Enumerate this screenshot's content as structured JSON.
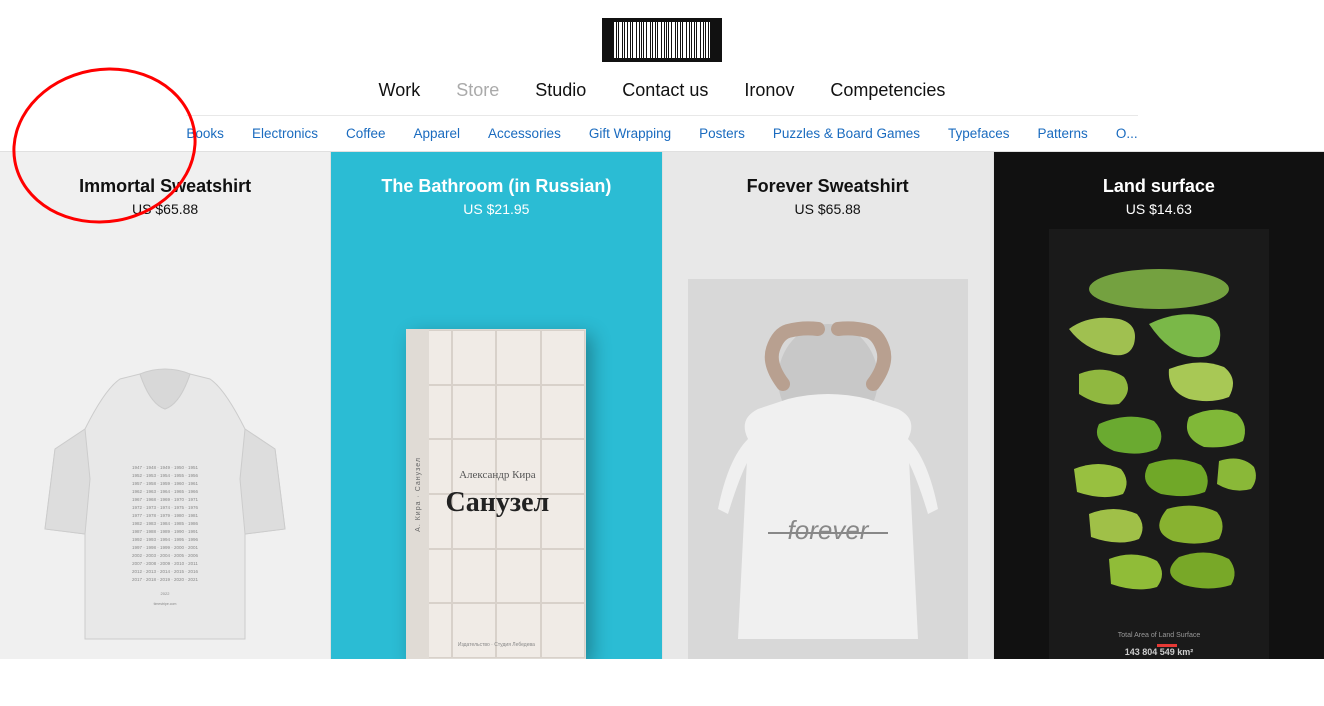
{
  "header": {
    "logo_alt": "Barcode Logo",
    "nav": [
      {
        "label": "Work",
        "href": "#",
        "active": true
      },
      {
        "label": "Store",
        "href": "#",
        "muted": true
      },
      {
        "label": "Studio",
        "href": "#"
      },
      {
        "label": "Contact us",
        "href": "#"
      },
      {
        "label": "Ironov",
        "href": "#"
      },
      {
        "label": "Competencies",
        "href": "#"
      }
    ],
    "subnav": [
      {
        "label": "Books",
        "href": "#"
      },
      {
        "label": "Electronics",
        "href": "#"
      },
      {
        "label": "Coffee",
        "href": "#"
      },
      {
        "label": "Apparel",
        "href": "#"
      },
      {
        "label": "Accessories",
        "href": "#"
      },
      {
        "label": "Gift Wrapping",
        "href": "#"
      },
      {
        "label": "Posters",
        "href": "#"
      },
      {
        "label": "Puzzles & Board Games",
        "href": "#"
      },
      {
        "label": "Typefaces",
        "href": "#"
      },
      {
        "label": "Patterns",
        "href": "#"
      },
      {
        "label": "O...",
        "href": "#"
      }
    ]
  },
  "products": [
    {
      "id": "immortal-sweatshirt",
      "title": "Immortal Sweatshirt",
      "price": "US $65.88",
      "bg": "light",
      "type": "sweatshirt"
    },
    {
      "id": "bathroom-book",
      "title": "The Bathroom (in Russian)",
      "price": "US $21.95",
      "bg": "teal",
      "type": "book",
      "book_title": "Санузел",
      "book_author": "Александр Кира"
    },
    {
      "id": "forever-sweatshirt",
      "title": "Forever Sweatshirt",
      "price": "US $65.88",
      "bg": "lightgray",
      "type": "forever"
    },
    {
      "id": "land-surface",
      "title": "Land surface",
      "price": "US $14.63",
      "bg": "dark",
      "type": "poster",
      "poster_text": "143 804 549 km²"
    }
  ]
}
